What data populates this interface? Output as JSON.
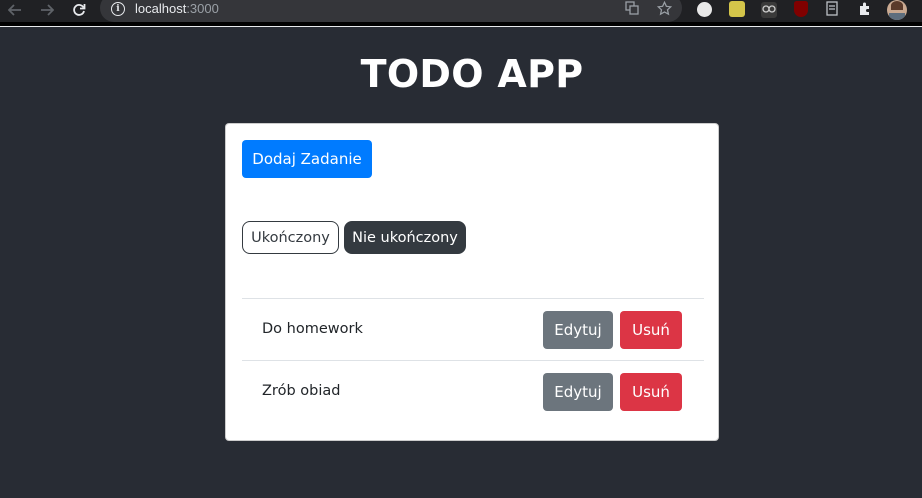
{
  "browser": {
    "url_host": "localhost",
    "url_port": ":3000",
    "back_icon": "arrow-left-icon",
    "forward_icon": "arrow-right-icon",
    "reload_icon": "reload-icon",
    "info_icon": "info-icon",
    "translate_icon": "translate-icon",
    "star_icon": "star-icon",
    "extensions": [
      "extension-1-icon",
      "extension-2-icon",
      "extension-3-icon",
      "ublock-icon",
      "extension-5-icon",
      "puzzle-icon",
      "profile-avatar"
    ]
  },
  "app": {
    "title": "TODO APP",
    "add_button": "Dodaj Zadanie",
    "filters": {
      "done": "Ukończony",
      "not_done": "Nie ukończony"
    },
    "tasks": [
      {
        "title": "Do homework",
        "edit": "Edytuj",
        "delete": "Usuń"
      },
      {
        "title": "Zrób obiad",
        "edit": "Edytuj",
        "delete": "Usuń"
      }
    ]
  },
  "colors": {
    "page_bg": "#282c34",
    "primary": "#007bff",
    "secondary": "#6c757d",
    "danger": "#dc3545",
    "dark": "#343a40"
  }
}
